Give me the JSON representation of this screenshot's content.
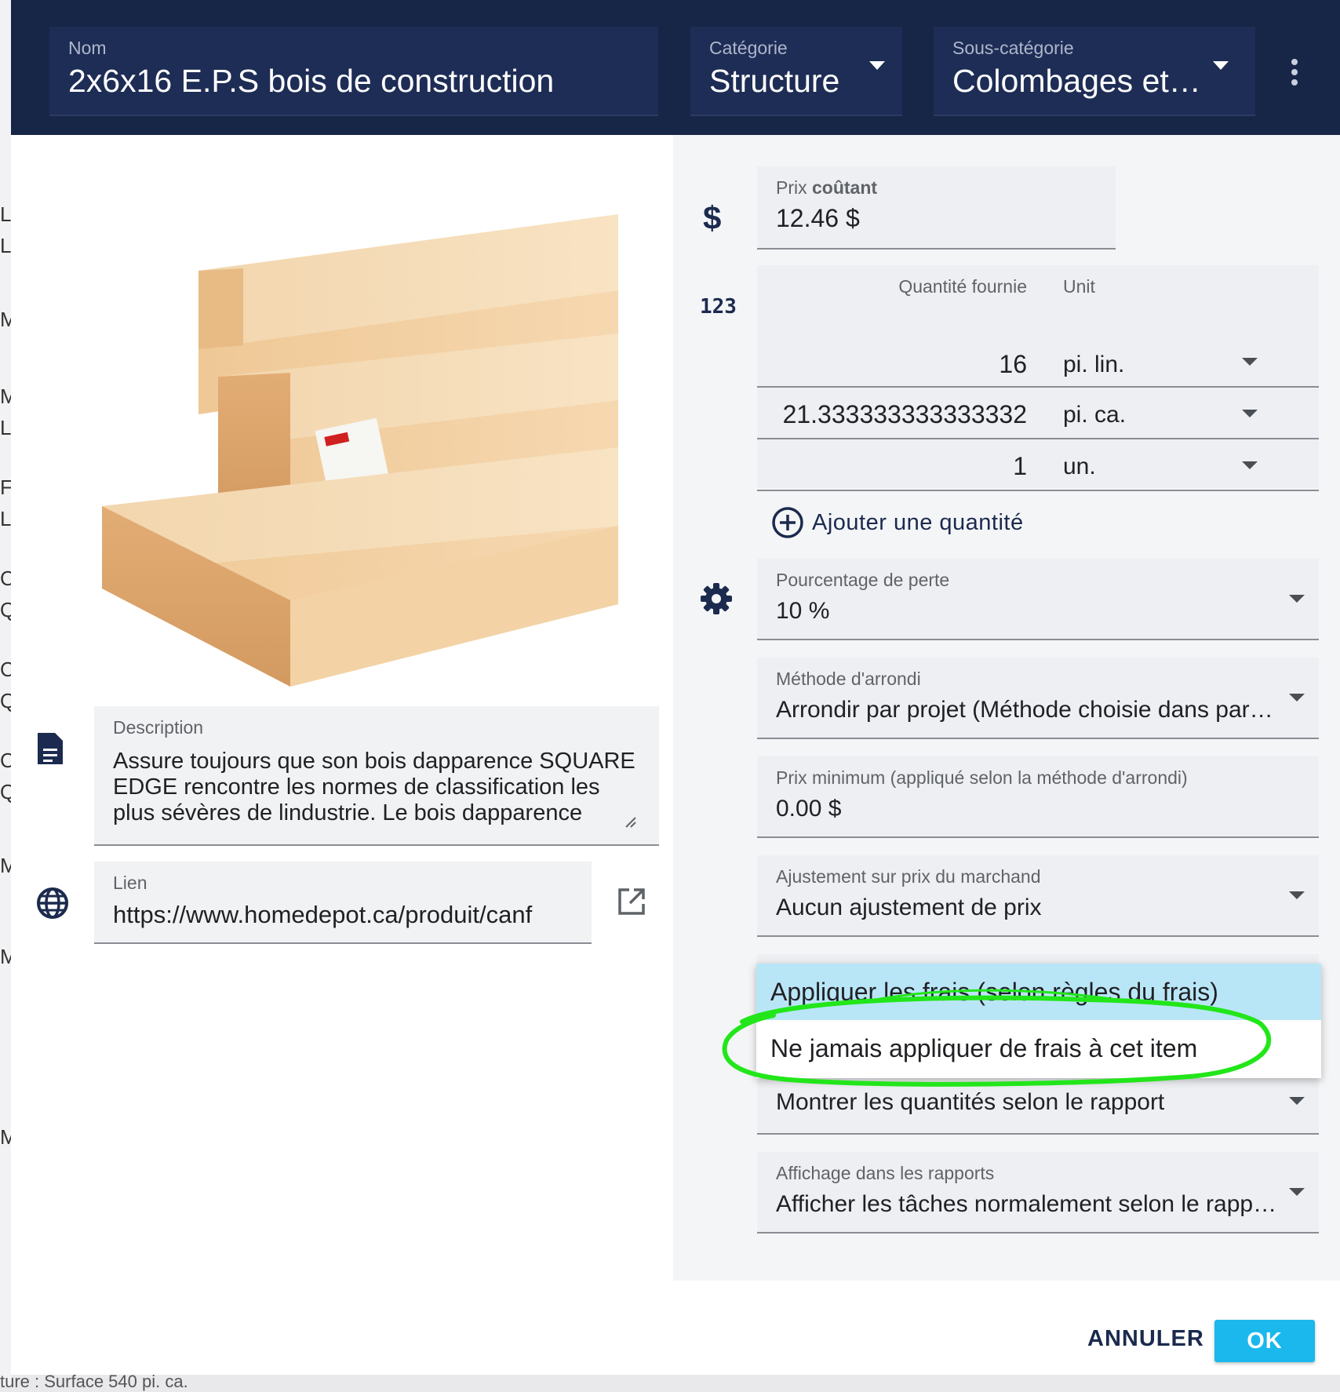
{
  "background": {
    "left_fragments": [
      "Li",
      "Lc",
      "M",
      "M",
      "Lc",
      "Fc",
      "Lc",
      "Cl",
      "Qu",
      "Cl",
      "Qu",
      "Cl",
      "Qu",
      "M",
      "M",
      "M"
    ],
    "bottom_text": "ture : Surface        540 pi. ca."
  },
  "header": {
    "name_label": "Nom",
    "name_value": "2x6x16 E.P.S bois de construction",
    "category_label": "Catégorie",
    "category_value": "Structure",
    "subcategory_label": "Sous-catégorie",
    "subcategory_value": "Colombages et…",
    "more_icon": "more-vert-icon"
  },
  "image": {
    "alt": "lumber-boards-image"
  },
  "description": {
    "label": "Description",
    "value": "Assure toujours que son bois dapparence SQUARE EDGE  rencontre les normes de classification les plus sévères de lindustrie. Le bois dapparence"
  },
  "link": {
    "label": "Lien",
    "value": "https://www.homedepot.ca/produit/canf"
  },
  "price": {
    "label_normal": "Prix ",
    "label_bold": "coûtant",
    "value": "12.46 $"
  },
  "quantities": {
    "header_qty": "Quantité fournie",
    "header_unit": "Unit",
    "rows": [
      {
        "qty": "16",
        "unit": "pi. lin."
      },
      {
        "qty": "21.333333333333332",
        "unit": "pi. ca."
      },
      {
        "qty": "1",
        "unit": "un."
      }
    ],
    "add_label": "Ajouter une quantité"
  },
  "loss": {
    "label": "Pourcentage de perte",
    "value": "10 %"
  },
  "rounding": {
    "label": "Méthode d'arrondi",
    "value": "Arrondir par projet (Méthode choisie dans par…"
  },
  "min_price": {
    "label": "Prix minimum (appliqué selon la méthode d'arrondi)",
    "value": "0.00 $"
  },
  "adjustment": {
    "label": "Ajustement sur prix du marchand",
    "value": "Aucun ajustement de prix"
  },
  "quantities_display": {
    "value": "Montrer les quantités selon le rapport"
  },
  "reports_display": {
    "label": "Affichage dans les rapports",
    "value": "Afficher les tâches normalement selon le rapp…"
  },
  "fees_menu": {
    "options": [
      "Appliquer les frais (selon règles du frais)",
      "Ne jamais appliquer de frais à cet item"
    ],
    "highlighted_index": 0
  },
  "buttons": {
    "cancel": "ANNULER",
    "ok": "OK"
  },
  "colors": {
    "header_bg": "#172547",
    "accent": "#1ab8ec",
    "menu_highlight": "#b9e6f7",
    "annotation": "#22e61a",
    "icon_navy": "#1b2a4e"
  }
}
